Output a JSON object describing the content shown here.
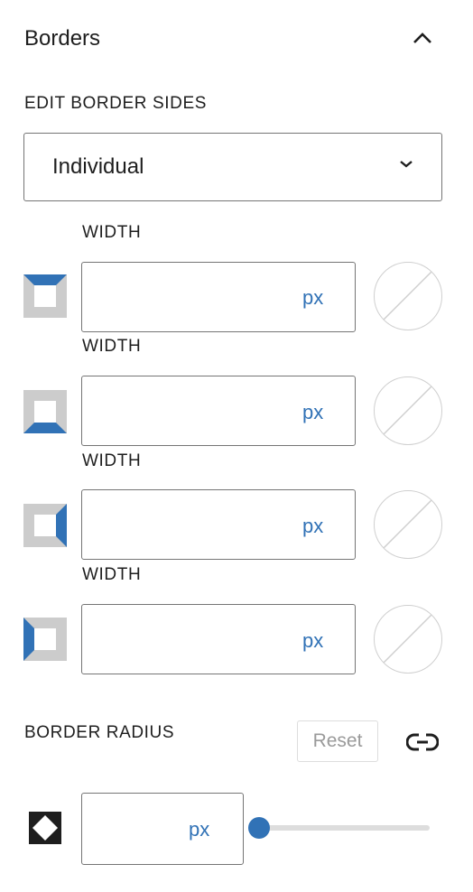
{
  "panel": {
    "title": "Borders"
  },
  "edit_sides": {
    "label": "EDIT BORDER SIDES",
    "selected": "Individual"
  },
  "sides": [
    {
      "side": "top",
      "label": "WIDTH",
      "value": "",
      "unit": "px"
    },
    {
      "side": "bottom",
      "label": "WIDTH",
      "value": "",
      "unit": "px"
    },
    {
      "side": "right",
      "label": "WIDTH",
      "value": "",
      "unit": "px"
    },
    {
      "side": "left",
      "label": "WIDTH",
      "value": "",
      "unit": "px"
    }
  ],
  "radius": {
    "label": "BORDER RADIUS",
    "reset_label": "Reset",
    "value": "",
    "unit": "px",
    "slider_fraction": 0
  },
  "colors": {
    "accent": "#3172b6",
    "icon_gray": "#cccccc",
    "text": "#1e1e1e",
    "border": "#757575"
  },
  "icons": {
    "collapse": "chevron-up-icon",
    "dropdown": "chevron-down-icon",
    "link": "link-icon",
    "radius": "border-radius-icon",
    "no_color": "no-color-icon"
  }
}
